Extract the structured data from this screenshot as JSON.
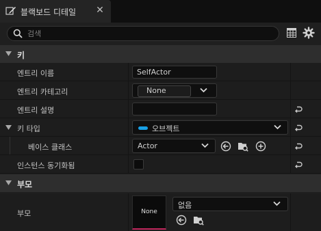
{
  "tab": {
    "title": "블랙보드 디테일",
    "icon": "pencil-edit-icon",
    "close": "✕"
  },
  "search": {
    "placeholder": "검색",
    "value": ""
  },
  "colors": {
    "object_type_pill": "#18a0e6",
    "thumb_underline": "#c1265c"
  },
  "sections": {
    "key": {
      "label": "키",
      "entry_name": {
        "label": "엔트리 이름",
        "value": "SelfActor"
      },
      "entry_category": {
        "label": "엔트리 카테고리",
        "value": "None"
      },
      "entry_description": {
        "label": "엔트리 설명",
        "value": ""
      },
      "key_type": {
        "label": "키 타입",
        "value": "오브젝트"
      },
      "base_class": {
        "label": "베이스 클래스",
        "value": "Actor"
      },
      "instance_synced": {
        "label": "인스턴스 동기화됨",
        "checked": false
      }
    },
    "parent": {
      "label": "부모",
      "parent_field": {
        "label": "부모",
        "thumbnail": "None",
        "value": "없음"
      }
    }
  }
}
